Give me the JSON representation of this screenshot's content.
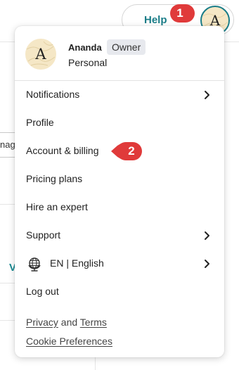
{
  "header": {
    "help_label": "Help",
    "avatar_initial": "A"
  },
  "callouts": {
    "first": "1",
    "second": "2",
    "color": "#e03a3a"
  },
  "background": {
    "select_fragment": "nag",
    "link_fragment": "V"
  },
  "menu": {
    "user": {
      "initial": "A",
      "name": "Ananda",
      "role": "Owner",
      "account_type": "Personal"
    },
    "items": [
      {
        "label": "Notifications",
        "has_submenu": true
      },
      {
        "label": "Profile",
        "has_submenu": false
      },
      {
        "label": "Account & billing",
        "has_submenu": false
      },
      {
        "label": "Pricing plans",
        "has_submenu": false
      },
      {
        "label": "Hire an expert",
        "has_submenu": false
      },
      {
        "label": "Support",
        "has_submenu": true
      }
    ],
    "language": {
      "icon": "globe-icon",
      "label": "EN | English",
      "has_submenu": true
    },
    "logout_label": "Log out",
    "footer": {
      "privacy": "Privacy",
      "and": "and",
      "terms": "Terms",
      "cookie": "Cookie Preferences"
    }
  },
  "colors": {
    "accent_teal": "#1a7d88",
    "avatar_bg": "#f5e7c6",
    "badge_bg": "#e7e9ee"
  }
}
